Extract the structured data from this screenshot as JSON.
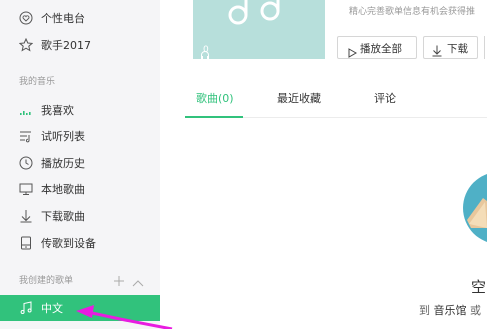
{
  "sidebar": {
    "top_items": [
      {
        "label": "个性电台",
        "icon": "radio-heart-icon"
      },
      {
        "label": "歌手2017",
        "icon": "star-icon"
      }
    ],
    "my_music_title": "我的音乐",
    "my_music_items": [
      {
        "label": "我喜欢",
        "icon": "equalizer-bars-icon"
      },
      {
        "label": "试听列表",
        "icon": "playlist-icon"
      },
      {
        "label": "播放历史",
        "icon": "clock-icon"
      },
      {
        "label": "本地歌曲",
        "icon": "monitor-icon"
      },
      {
        "label": "下载歌曲",
        "icon": "download-arrow-icon"
      },
      {
        "label": "传歌到设备",
        "icon": "device-icon"
      }
    ],
    "created_title": "我创建的歌单",
    "created_items": [
      {
        "label": "中文",
        "icon": "music-note-icon",
        "active": true
      }
    ]
  },
  "playlist": {
    "cover_play_count": "0",
    "description": "精心完善歌单信息有机会获得推",
    "play_all_label": "播放全部",
    "download_label": "下载"
  },
  "tabs": [
    {
      "label": "歌曲(0)",
      "active": true
    },
    {
      "label": "最近收藏",
      "active": false
    },
    {
      "label": "评论",
      "active": false
    }
  ],
  "empty_state": {
    "title": "空",
    "prefix": "到",
    "link": "音乐馆",
    "suffix": "或"
  },
  "colors": {
    "accent": "#31c27c",
    "sidebar_bg": "#f5f5f7",
    "annotation_arrow": "#e81ce0"
  }
}
